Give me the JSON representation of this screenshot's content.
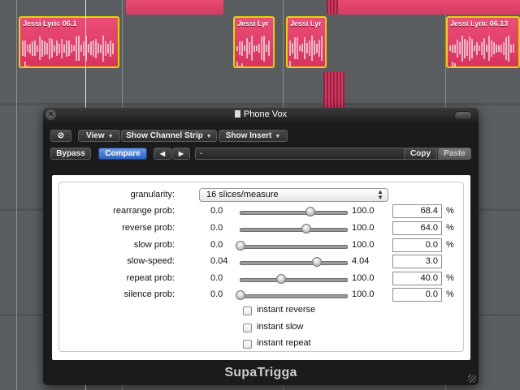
{
  "arrange": {
    "regions": [
      {
        "name": "Jessi Lyric 06.1"
      },
      {
        "name": "Jessi Lyr"
      },
      {
        "name": "Jessi Lyr"
      },
      {
        "name": "Jessi Lyric 06.13"
      }
    ]
  },
  "plugin": {
    "title": "Phone Vox",
    "toolbar": {
      "view": "View",
      "show_channel_strip": "Show Channel Strip",
      "show_insert": "Show Insert",
      "bypass": "Bypass",
      "compare": "Compare",
      "prev": "◀",
      "next": "▶",
      "preset": "-",
      "copy": "Copy",
      "paste": "Paste"
    },
    "granularity": {
      "label": "granularity:",
      "value": "16 slices/measure"
    },
    "params": [
      {
        "label": "rearrange prob:",
        "min": "0.0",
        "max": "100.0",
        "value": "68.4",
        "unit": "%",
        "fraction": 0.66
      },
      {
        "label": "reverse prob:",
        "min": "0.0",
        "max": "100.0",
        "value": "64.0",
        "unit": "%",
        "fraction": 0.62
      },
      {
        "label": "slow prob:",
        "min": "0.0",
        "max": "100.0",
        "value": "0.0",
        "unit": "%",
        "fraction": 0.0
      },
      {
        "label": "slow-speed:",
        "min": "0.04",
        "max": "4.04",
        "value": "3.0",
        "unit": "",
        "fraction": 0.72
      },
      {
        "label": "repeat prob:",
        "min": "0.0",
        "max": "100.0",
        "value": "40.0",
        "unit": "%",
        "fraction": 0.38
      },
      {
        "label": "silence prob:",
        "min": "0.0",
        "max": "100.0",
        "value": "0.0",
        "unit": "%",
        "fraction": 0.0
      }
    ],
    "checkboxes": [
      {
        "label": "instant reverse",
        "checked": false
      },
      {
        "label": "instant slow",
        "checked": false
      },
      {
        "label": "instant repeat",
        "checked": false
      }
    ],
    "footer": "SupaTrigga"
  }
}
